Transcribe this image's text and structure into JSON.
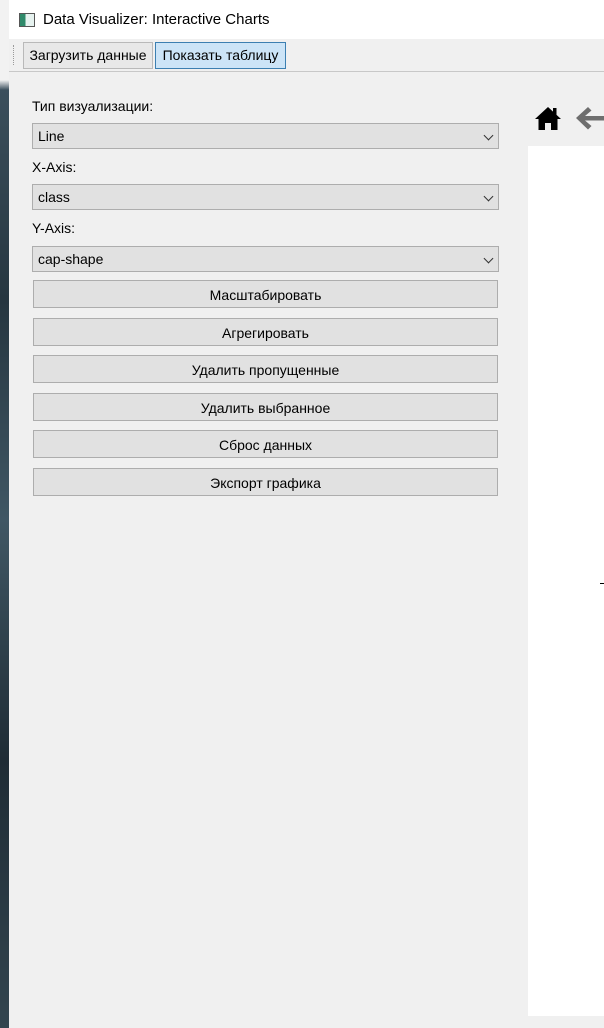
{
  "window": {
    "title": "Data Visualizer: Interactive Charts"
  },
  "toolbar": {
    "load_label": "Загрузить данные",
    "show_table_label": "Показать таблицу"
  },
  "controls": {
    "viz_type_label": "Тип визуализации:",
    "viz_type_value": "Line",
    "x_axis_label": "X-Axis:",
    "x_axis_value": "class",
    "y_axis_label": "Y-Axis:",
    "y_axis_value": "cap-shape"
  },
  "actions": [
    {
      "label": "Масштабировать"
    },
    {
      "label": "Агрегировать"
    },
    {
      "label": "Удалить пропущенные"
    },
    {
      "label": "Удалить выбранное"
    },
    {
      "label": "Сброс данных"
    },
    {
      "label": "Экспорт графика"
    }
  ],
  "chart_nav": {
    "icons": [
      "home-icon",
      "back-arrow-icon"
    ]
  },
  "colors": {
    "window_bg": "#f0f0f0",
    "titlebar_bg": "#ffffff",
    "active_button_bg": "#cce4f7",
    "active_button_border": "#3c7fb1",
    "control_bg": "#e1e1e1",
    "chart_bg": "#ffffff"
  }
}
